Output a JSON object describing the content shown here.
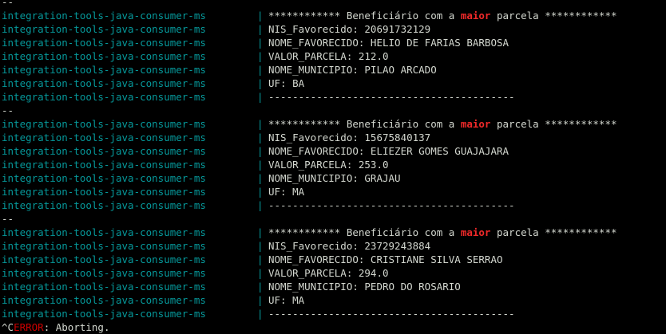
{
  "terminal": {
    "service_name": "integration-tools-java-consumer-ms",
    "pipe": "|",
    "group_separator": "--",
    "header": {
      "before": "************ Beneficiário com a ",
      "highlight": "maior",
      "after": " parcela ************"
    },
    "divider": "-----------------------------------------",
    "groups": [
      {
        "nis": "NIS_Favorecido: 20691732129",
        "nome": "NOME_FAVORECIDO: HELIO DE FARIAS BARBOSA",
        "valor": "VALOR_PARCELA: 212.0",
        "municipio": "NOME_MUNICIPIO: PILAO ARCADO",
        "uf": "UF: BA"
      },
      {
        "nis": "NIS_Favorecido: 15675840137",
        "nome": "NOME_FAVORECIDO: ELIEZER GOMES GUAJAJARA",
        "valor": "VALOR_PARCELA: 253.0",
        "municipio": "NOME_MUNICIPIO: GRAJAU",
        "uf": "UF: MA"
      },
      {
        "nis": "NIS_Favorecido: 23729243884",
        "nome": "NOME_FAVORECIDO: CRISTIANE SILVA SERRAO",
        "valor": "VALOR_PARCELA: 294.0",
        "municipio": "NOME_MUNICIPIO: PEDRO DO ROSARIO",
        "uf": "UF: MA"
      }
    ],
    "error_line": {
      "prefix": "^C",
      "error_word": "ERROR",
      "message": ": Aborting."
    }
  },
  "colors": {
    "background": "#000000",
    "service": "#06989a",
    "text": "#d3d7cf",
    "highlight": "#ef2929",
    "error": "#cc0000"
  }
}
